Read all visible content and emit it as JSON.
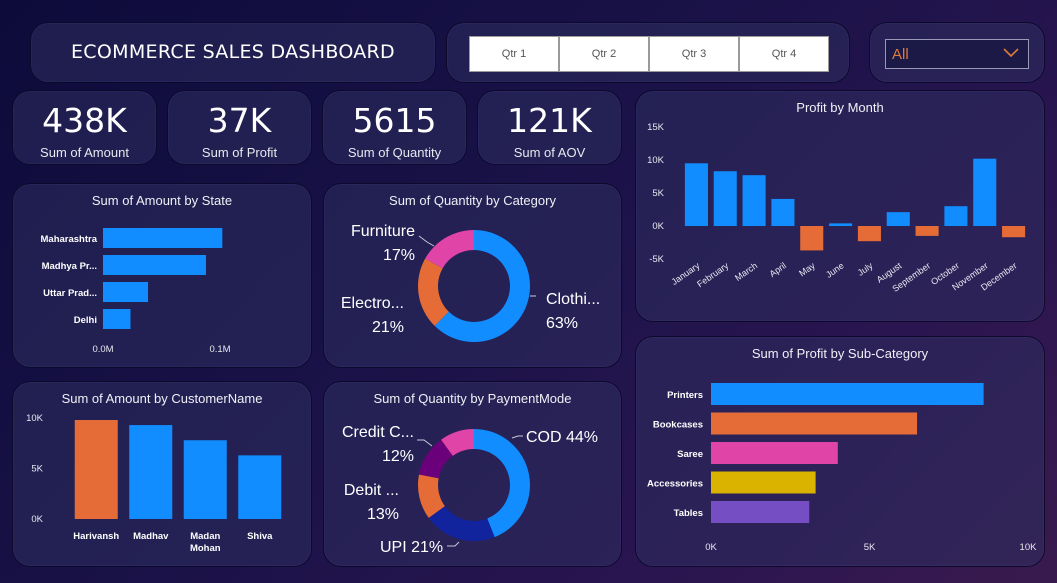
{
  "header": {
    "title": "ECOMMERCE SALES DASHBOARD"
  },
  "quarters": [
    "Qtr 1",
    "Qtr 2",
    "Qtr 3",
    "Qtr 4"
  ],
  "filter": {
    "selected": "All"
  },
  "kpis": [
    {
      "value": "438K",
      "label": "Sum of Amount"
    },
    {
      "value": "37K",
      "label": "Sum of Profit"
    },
    {
      "value": "5615",
      "label": "Sum of Quantity"
    },
    {
      "value": "121K",
      "label": "Sum of AOV"
    }
  ],
  "colors": {
    "blue": "#118dff",
    "orange": "#e66c37",
    "pink": "#e044a7",
    "navy": "#12239e",
    "purple": "#6b007b",
    "yellow": "#d9b300",
    "violet": "#744ec2"
  },
  "chart_data": [
    {
      "id": "amount_by_state",
      "type": "bar",
      "orientation": "horizontal",
      "title": "Sum of Amount by State",
      "categories": [
        "Maharashtra",
        "Madhya Pr...",
        "Uttar Prad...",
        "Delhi"
      ],
      "values": [
        0.102,
        0.088,
        0.0385,
        0.0235
      ],
      "xticks": [
        "0.0M",
        "0.1M"
      ],
      "xlim": [
        0,
        0.1
      ],
      "color": "#118dff"
    },
    {
      "id": "quantity_by_category",
      "type": "pie",
      "donut": true,
      "title": "Sum of Quantity by Category",
      "labels": [
        "Clothi...",
        "Electro...",
        "Furniture"
      ],
      "values": [
        63,
        21,
        17
      ],
      "percent_labels": [
        "63%",
        "21%",
        "17%"
      ],
      "colors": [
        "#118dff",
        "#e66c37",
        "#e044a7"
      ]
    },
    {
      "id": "profit_by_month",
      "type": "bar",
      "title": "Profit by Month",
      "categories": [
        "January",
        "February",
        "March",
        "April",
        "May",
        "June",
        "July",
        "August",
        "September",
        "October",
        "November",
        "December"
      ],
      "values": [
        9500,
        8300,
        7700,
        4100,
        -3700,
        400,
        -2300,
        2100,
        -1500,
        3000,
        10200,
        -1700
      ],
      "yticks": [
        "15K",
        "10K",
        "5K",
        "0K",
        "-5K"
      ],
      "ylim": [
        -5000,
        15000
      ],
      "colors": {
        "positive": "#118dff",
        "negative": "#e66c37"
      }
    },
    {
      "id": "amount_by_customer",
      "type": "bar",
      "title": "Sum of Amount by CustomerName",
      "categories": [
        "Harivansh",
        "Madhav",
        "Madan Mohan",
        "Shiva"
      ],
      "category_lines": [
        [
          "Harivansh"
        ],
        [
          "Madhav"
        ],
        [
          "Madan",
          "Mohan"
        ],
        [
          "Shiva"
        ]
      ],
      "values": [
        9800,
        9300,
        7800,
        6300
      ],
      "yticks": [
        "10K",
        "5K",
        "0K"
      ],
      "ylim": [
        0,
        10000
      ],
      "colors": [
        "#e66c37",
        "#118dff",
        "#118dff",
        "#118dff"
      ]
    },
    {
      "id": "quantity_by_paymentmode",
      "type": "pie",
      "donut": true,
      "title": "Sum of Quantity by PaymentMode",
      "labels": [
        "COD",
        "UPI",
        "Debit ...",
        "Credit C..."
      ],
      "values": [
        44,
        21,
        13,
        12,
        10
      ],
      "label_texts": [
        "COD 44%",
        "UPI 21%",
        "Debit ...",
        "Credit C..."
      ],
      "percent_labels": [
        "",
        "",
        "13%",
        "12%"
      ],
      "colors": [
        "#118dff",
        "#12239e",
        "#e66c37",
        "#6b007b",
        "#e044a7"
      ]
    },
    {
      "id": "profit_by_subcategory",
      "type": "bar",
      "orientation": "horizontal",
      "title": "Sum of Profit by Sub-Category",
      "categories": [
        "Printers",
        "Bookcases",
        "Saree",
        "Accessories",
        "Tables"
      ],
      "values": [
        8600,
        6500,
        4000,
        3300,
        3100
      ],
      "xticks": [
        "0K",
        "5K",
        "10K"
      ],
      "xlim": [
        0,
        10000
      ],
      "colors": [
        "#118dff",
        "#e66c37",
        "#e044a7",
        "#d9b300",
        "#744ec2"
      ]
    }
  ]
}
